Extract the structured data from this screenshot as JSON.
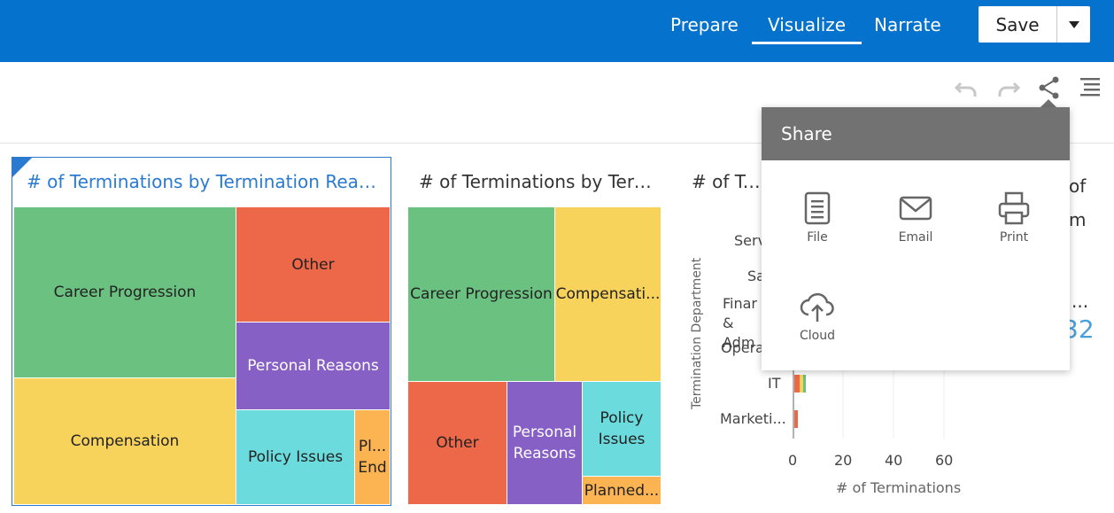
{
  "nav": {
    "tabs": [
      {
        "label": "Prepare"
      },
      {
        "label": "Visualize"
      },
      {
        "label": "Narrate"
      }
    ],
    "save_label": "Save"
  },
  "colors": {
    "brand": "#0572ce",
    "green": "#6bc180",
    "yellow": "#f7d35c",
    "red": "#ed6749",
    "purple": "#8760c5",
    "cyan": "#6cdbde",
    "orange": "#fcb452"
  },
  "viz1": {
    "title": "# of Terminations by Termination Reason",
    "cells": [
      {
        "label": "Career Progression"
      },
      {
        "label": "Other"
      },
      {
        "label": "Personal Reasons"
      },
      {
        "label": "Compensation"
      },
      {
        "label": "Policy Issues"
      },
      {
        "label": "Pl... End"
      }
    ]
  },
  "viz2": {
    "title": "# of Terminations by Term...",
    "cells": [
      {
        "label": "Career Progression"
      },
      {
        "label": "Compensati..."
      },
      {
        "label": "Other"
      },
      {
        "label": "Personal Reasons"
      },
      {
        "label": "Policy Issues"
      },
      {
        "label": "Planned..."
      }
    ]
  },
  "viz3": {
    "title": "# of Term",
    "title_right_1": "of",
    "title_right_2": "m",
    "ellipsis": "...",
    "kpi_fragment": "32",
    "ylabel": "Termination Department",
    "xlabel": "# of Terminations",
    "categories": [
      "Serv",
      "Sa",
      "Finar & Adm",
      "Opera",
      "IT",
      "Marketi..."
    ],
    "x_ticks": [
      "0",
      "20",
      "40",
      "60"
    ]
  },
  "share": {
    "title": "Share",
    "items": [
      {
        "label": "File",
        "icon": "file-icon"
      },
      {
        "label": "Email",
        "icon": "email-icon"
      },
      {
        "label": "Print",
        "icon": "print-icon"
      },
      {
        "label": "Cloud",
        "icon": "cloud-icon"
      }
    ]
  }
}
